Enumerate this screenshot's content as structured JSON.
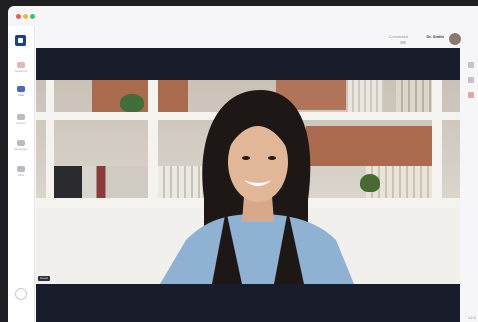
{
  "window": {
    "controls": [
      "close",
      "minimize",
      "zoom"
    ]
  },
  "sidebar": {
    "logo": "app-logo",
    "items": [
      {
        "label": "Sessions",
        "icon": "calendar-icon"
      },
      {
        "label": "Live",
        "icon": "video-icon"
      },
      {
        "label": "Clients",
        "icon": "people-icon"
      },
      {
        "label": "Messages",
        "icon": "chat-icon"
      },
      {
        "label": "Files",
        "icon": "document-icon"
      }
    ],
    "bottom_icon": "help-icon"
  },
  "header": {
    "status": "Connected",
    "user_name": "Dr. Smith",
    "avatar": "user-avatar"
  },
  "right_rail": {
    "icons": [
      "settings-icon",
      "share-icon",
      "leave-icon"
    ]
  },
  "video": {
    "participant_label": "Guest",
    "description_colors": {
      "stage_bg": "#181c2b",
      "accent": "#4a66c9"
    }
  },
  "footer": {
    "mark": "v2.0"
  }
}
